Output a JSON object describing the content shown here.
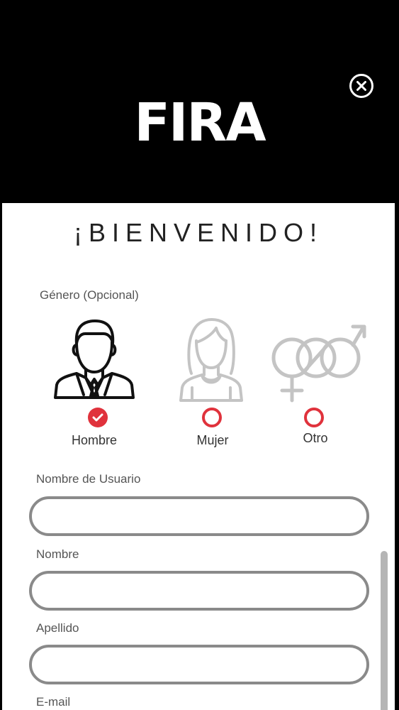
{
  "header": {
    "logo_text": "FIRA",
    "close_icon": "close-circle-icon"
  },
  "welcome": "¡BIENVENIDO!",
  "gender": {
    "label": "Género (Opcional)",
    "accent_color": "#e0323c",
    "options": [
      {
        "label": "Hombre",
        "icon": "man-icon",
        "selected": true
      },
      {
        "label": "Mujer",
        "icon": "woman-icon",
        "selected": false
      },
      {
        "label": "Otro",
        "icon": "gender-symbols-icon",
        "selected": false
      }
    ]
  },
  "fields": [
    {
      "label": "Nombre de Usuario",
      "value": ""
    },
    {
      "label": "Nombre",
      "value": ""
    },
    {
      "label": "Apellido",
      "value": ""
    },
    {
      "label": "E-mail",
      "value": ""
    }
  ]
}
